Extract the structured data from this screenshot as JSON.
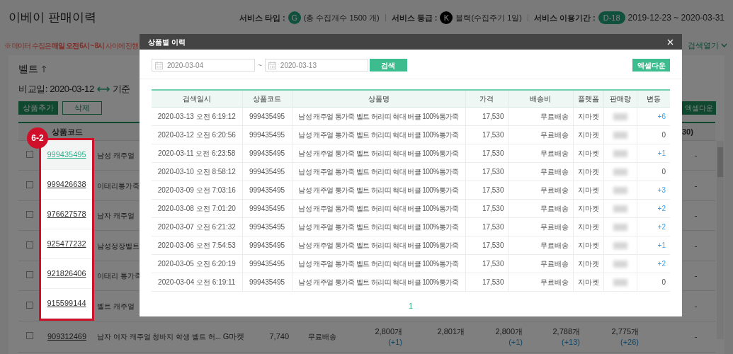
{
  "header": {
    "title": "이베이 판매이력",
    "service_type_label": "서비스 타입 :",
    "service_type_badge": "G",
    "service_type_value": "(총 수집개수 1500 개)",
    "grade_label": "서비스 등급 :",
    "grade_badge": "K",
    "grade_value": "블랙(수집주기 1일)",
    "period_label": "서비스 이용기간 :",
    "period_badge": "D-18",
    "period_value": "2019-12-23 ~ 2020-03-31"
  },
  "notice": "※ 데이터 수집은 **매일 오전 6시 ~ 8시** 사이에 진행",
  "search_toggle": "검색열기",
  "panel": {
    "title": "벨트",
    "compare_date": "비교일: 2020-03-12",
    "base_date": "기준",
    "add_button": "상품추가",
    "delete_button": "삭제",
    "excel_button": "엑셀다운"
  },
  "table": {
    "columns": [
      "상품코드"
    ],
    "column_partial": "30)",
    "rows": [
      {
        "checked": false,
        "code": "999435495",
        "name": "남성 캐주얼",
        "selected": true,
        "last": "-"
      },
      {
        "checked": false,
        "code": "999426638",
        "name": "이태리통가죽",
        "selected": false,
        "last": "-"
      },
      {
        "checked": false,
        "code": "976627578",
        "name": "남자 캐주얼",
        "selected": false,
        "last": "-"
      },
      {
        "checked": false,
        "code": "925477232",
        "name": "남성정장벨트",
        "selected": false,
        "last": "-"
      },
      {
        "checked": false,
        "code": "921826406",
        "name": "이태리 통가죽",
        "selected": false,
        "last": "-"
      },
      {
        "checked": false,
        "code": "915599144",
        "name": "벨트 캐주얼",
        "selected": false,
        "last": "-"
      }
    ],
    "bottom_row": {
      "checked": false,
      "code": "909312469",
      "name": "남자 여자 캐주얼 청바지 학생 벨트 허...",
      "platform": "G마켓",
      "price": "7,740",
      "shipping": "무료배송",
      "counts": [
        {
          "value": "2,800개",
          "diff": "(+1)"
        },
        {
          "value": "2,801개"
        },
        {
          "value": "2,800개",
          "diff": "(+1)"
        },
        {
          "value": "2,788개",
          "diff": "(+13)"
        },
        {
          "value": "2,775개",
          "diff": "(+26)"
        }
      ],
      "last": "-"
    }
  },
  "annotation": {
    "label": "6-2"
  },
  "modal": {
    "title": "상품별 이력",
    "date_from": "2020-03-04",
    "date_separator": "~",
    "date_to": "2020-03-13",
    "search_button": "검색",
    "excel_button": "엑셀다운",
    "columns": [
      "검색일시",
      "상품코드",
      "상품명",
      "가격",
      "배송비",
      "플랫폼",
      "판매량",
      "변동"
    ],
    "rows": [
      {
        "datetime": "2020-03-13 오전 6:19:12",
        "code": "999435495",
        "name": "남성 캐주얼 통가죽 벨트 허리띠 혁대 버클 100%통가죽",
        "price": "17,530",
        "shipping": "무료배송",
        "platform": "지마켓",
        "change": "+6",
        "increase": true
      },
      {
        "datetime": "2020-03-12 오전 6:20:56",
        "code": "999435495",
        "name": "남성 캐주얼 통가죽 벨트 허리띠 혁대 버클 100%통가죽",
        "price": "17,530",
        "shipping": "무료배송",
        "platform": "지마켓",
        "change": "0",
        "increase": false
      },
      {
        "datetime": "2020-03-11 오전 6:23:58",
        "code": "999435495",
        "name": "남성 캐주얼 통가죽 벨트 허리띠 혁대 버클 100%통가죽",
        "price": "17,530",
        "shipping": "무료배송",
        "platform": "지마켓",
        "change": "+1",
        "increase": true
      },
      {
        "datetime": "2020-03-10 오전 8:58:12",
        "code": "999435495",
        "name": "남성 캐주얼 통가죽 벨트 허리띠 혁대 버클 100%통가죽",
        "price": "17,530",
        "shipping": "무료배송",
        "platform": "지마켓",
        "change": "0",
        "increase": false
      },
      {
        "datetime": "2020-03-09 오전 7:03:16",
        "code": "999435495",
        "name": "남성 캐주얼 통가죽 벨트 허리띠 혁대 버클 100%통가죽",
        "price": "17,530",
        "shipping": "무료배송",
        "platform": "지마켓",
        "change": "+3",
        "increase": true
      },
      {
        "datetime": "2020-03-08 오전 7:01:20",
        "code": "999435495",
        "name": "남성 캐주얼 통가죽 벨트 허리띠 혁대 버클 100%통가죽",
        "price": "17,530",
        "shipping": "무료배송",
        "platform": "지마켓",
        "change": "+2",
        "increase": true
      },
      {
        "datetime": "2020-03-07 오전 6:21:32",
        "code": "999435495",
        "name": "남성 캐주얼 통가죽 벨트 허리띠 혁대 버클 100%통가죽",
        "price": "17,530",
        "shipping": "무료배송",
        "platform": "지마켓",
        "change": "+2",
        "increase": true
      },
      {
        "datetime": "2020-03-06 오전 7:54:53",
        "code": "999435495",
        "name": "남성 캐주얼 통가죽 벨트 허리띠 혁대 버클 100%통가죽",
        "price": "17,530",
        "shipping": "무료배송",
        "platform": "지마켓",
        "change": "+1",
        "increase": true
      },
      {
        "datetime": "2020-03-05 오전 6:20:19",
        "code": "999435495",
        "name": "남성 캐주얼 통가죽 벨트 허리띠 혁대 버클 100%통가죽",
        "price": "17,530",
        "shipping": "무료배송",
        "platform": "지마켓",
        "change": "+2",
        "increase": true
      },
      {
        "datetime": "2020-03-04 오전 6:19:11",
        "code": "999435495",
        "name": "남성 캐주얼 통가죽 벨트 허리띠 혁대 버클 100%통가죽",
        "price": "17,530",
        "shipping": "무료배송",
        "platform": "지마켓",
        "change": "0",
        "increase": false
      }
    ],
    "pages": [
      {
        "label": "1",
        "selected": true
      }
    ]
  }
}
